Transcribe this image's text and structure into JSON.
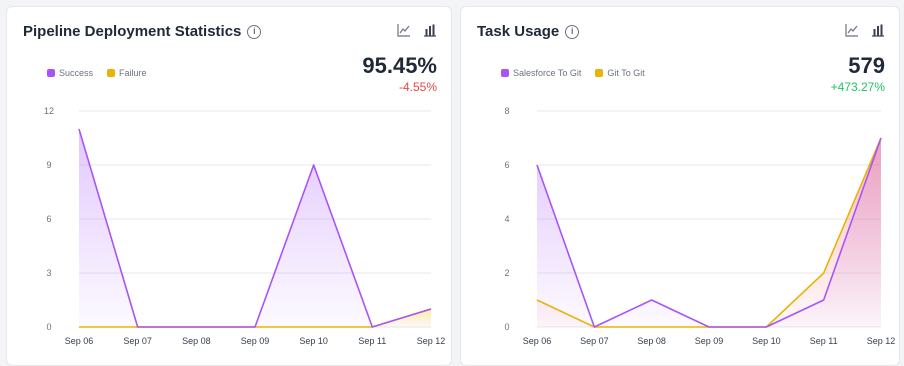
{
  "cards": [
    {
      "title": "Pipeline Deployment Statistics",
      "big_value": "95.45%",
      "delta": "-4.55%",
      "delta_color": "#ef4444",
      "icons": [
        "line-chart-icon",
        "bar-chart-icon"
      ]
    },
    {
      "title": "Task Usage",
      "big_value": "579",
      "delta": "+473.27%",
      "delta_color": "#22c55e",
      "icons": [
        "line-chart-icon",
        "bar-chart-icon"
      ]
    }
  ],
  "chart_data": [
    {
      "type": "line",
      "title": "Pipeline Deployment Statistics",
      "categories": [
        "Sep 06",
        "Sep 07",
        "Sep 08",
        "Sep 09",
        "Sep 10",
        "Sep 11",
        "Sep 12"
      ],
      "y_ticks": [
        0,
        3,
        6,
        9,
        12
      ],
      "ylim": [
        0,
        12
      ],
      "grid": true,
      "legend_placement": "top-left",
      "series": [
        {
          "name": "Success",
          "color": "#a855f7",
          "fill": "#c084fc",
          "values": [
            11,
            0,
            0,
            0,
            9,
            0,
            1
          ]
        },
        {
          "name": "Failure",
          "color": "#eab308",
          "fill": "#fde047",
          "values": [
            0,
            0,
            0,
            0,
            0,
            0,
            1
          ]
        }
      ]
    },
    {
      "type": "line",
      "title": "Task Usage",
      "categories": [
        "Sep 06",
        "Sep 07",
        "Sep 08",
        "Sep 09",
        "Sep 10",
        "Sep 11",
        "Sep 12"
      ],
      "y_ticks": [
        0,
        2,
        4,
        6,
        8
      ],
      "ylim": [
        0,
        8
      ],
      "grid": true,
      "legend_placement": "top-left",
      "series": [
        {
          "name": "Salesforce To Git",
          "color": "#a855f7",
          "fill": "#c084fc",
          "values": [
            6,
            0,
            1,
            0,
            0,
            1,
            7
          ]
        },
        {
          "name": "Git To Git",
          "color": "#eab308",
          "fill": "#f87171",
          "values": [
            1,
            0,
            0,
            0,
            0,
            2,
            7
          ]
        }
      ]
    }
  ]
}
